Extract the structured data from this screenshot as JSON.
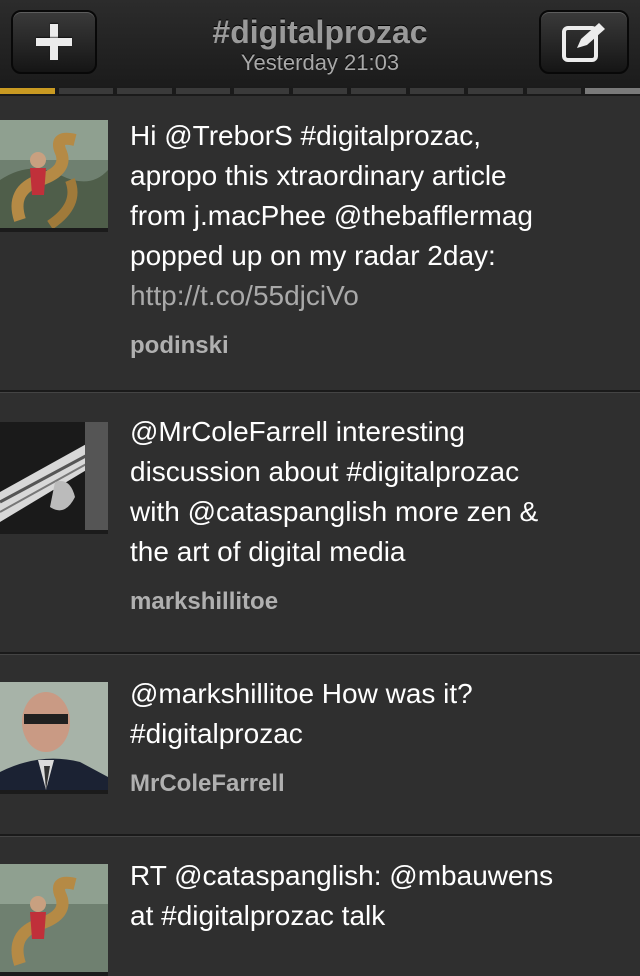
{
  "nav": {
    "title": "#digitalprozac",
    "subtitle": "Yesterday 21:03"
  },
  "tweets": [
    {
      "text": "Hi @TreborS #digitalprozac,\napropo this xtraordinary article\nfrom j.macPhee @thebafflermag\npopped up on my radar 2day:",
      "link": "http://t.co/55djciVo",
      "user": "podinski"
    },
    {
      "text": "@MrColeFarrell interesting\ndiscussion about #digitalprozac\nwith @cataspanglish more zen &\nthe art of digital media",
      "user": "markshillitoe"
    },
    {
      "text": "@markshillitoe How was it?\n#digitalprozac",
      "user": "MrColeFarrell"
    },
    {
      "text": "RT @cataspanglish: @mbauwens\nat #digitalprozac talk"
    }
  ]
}
